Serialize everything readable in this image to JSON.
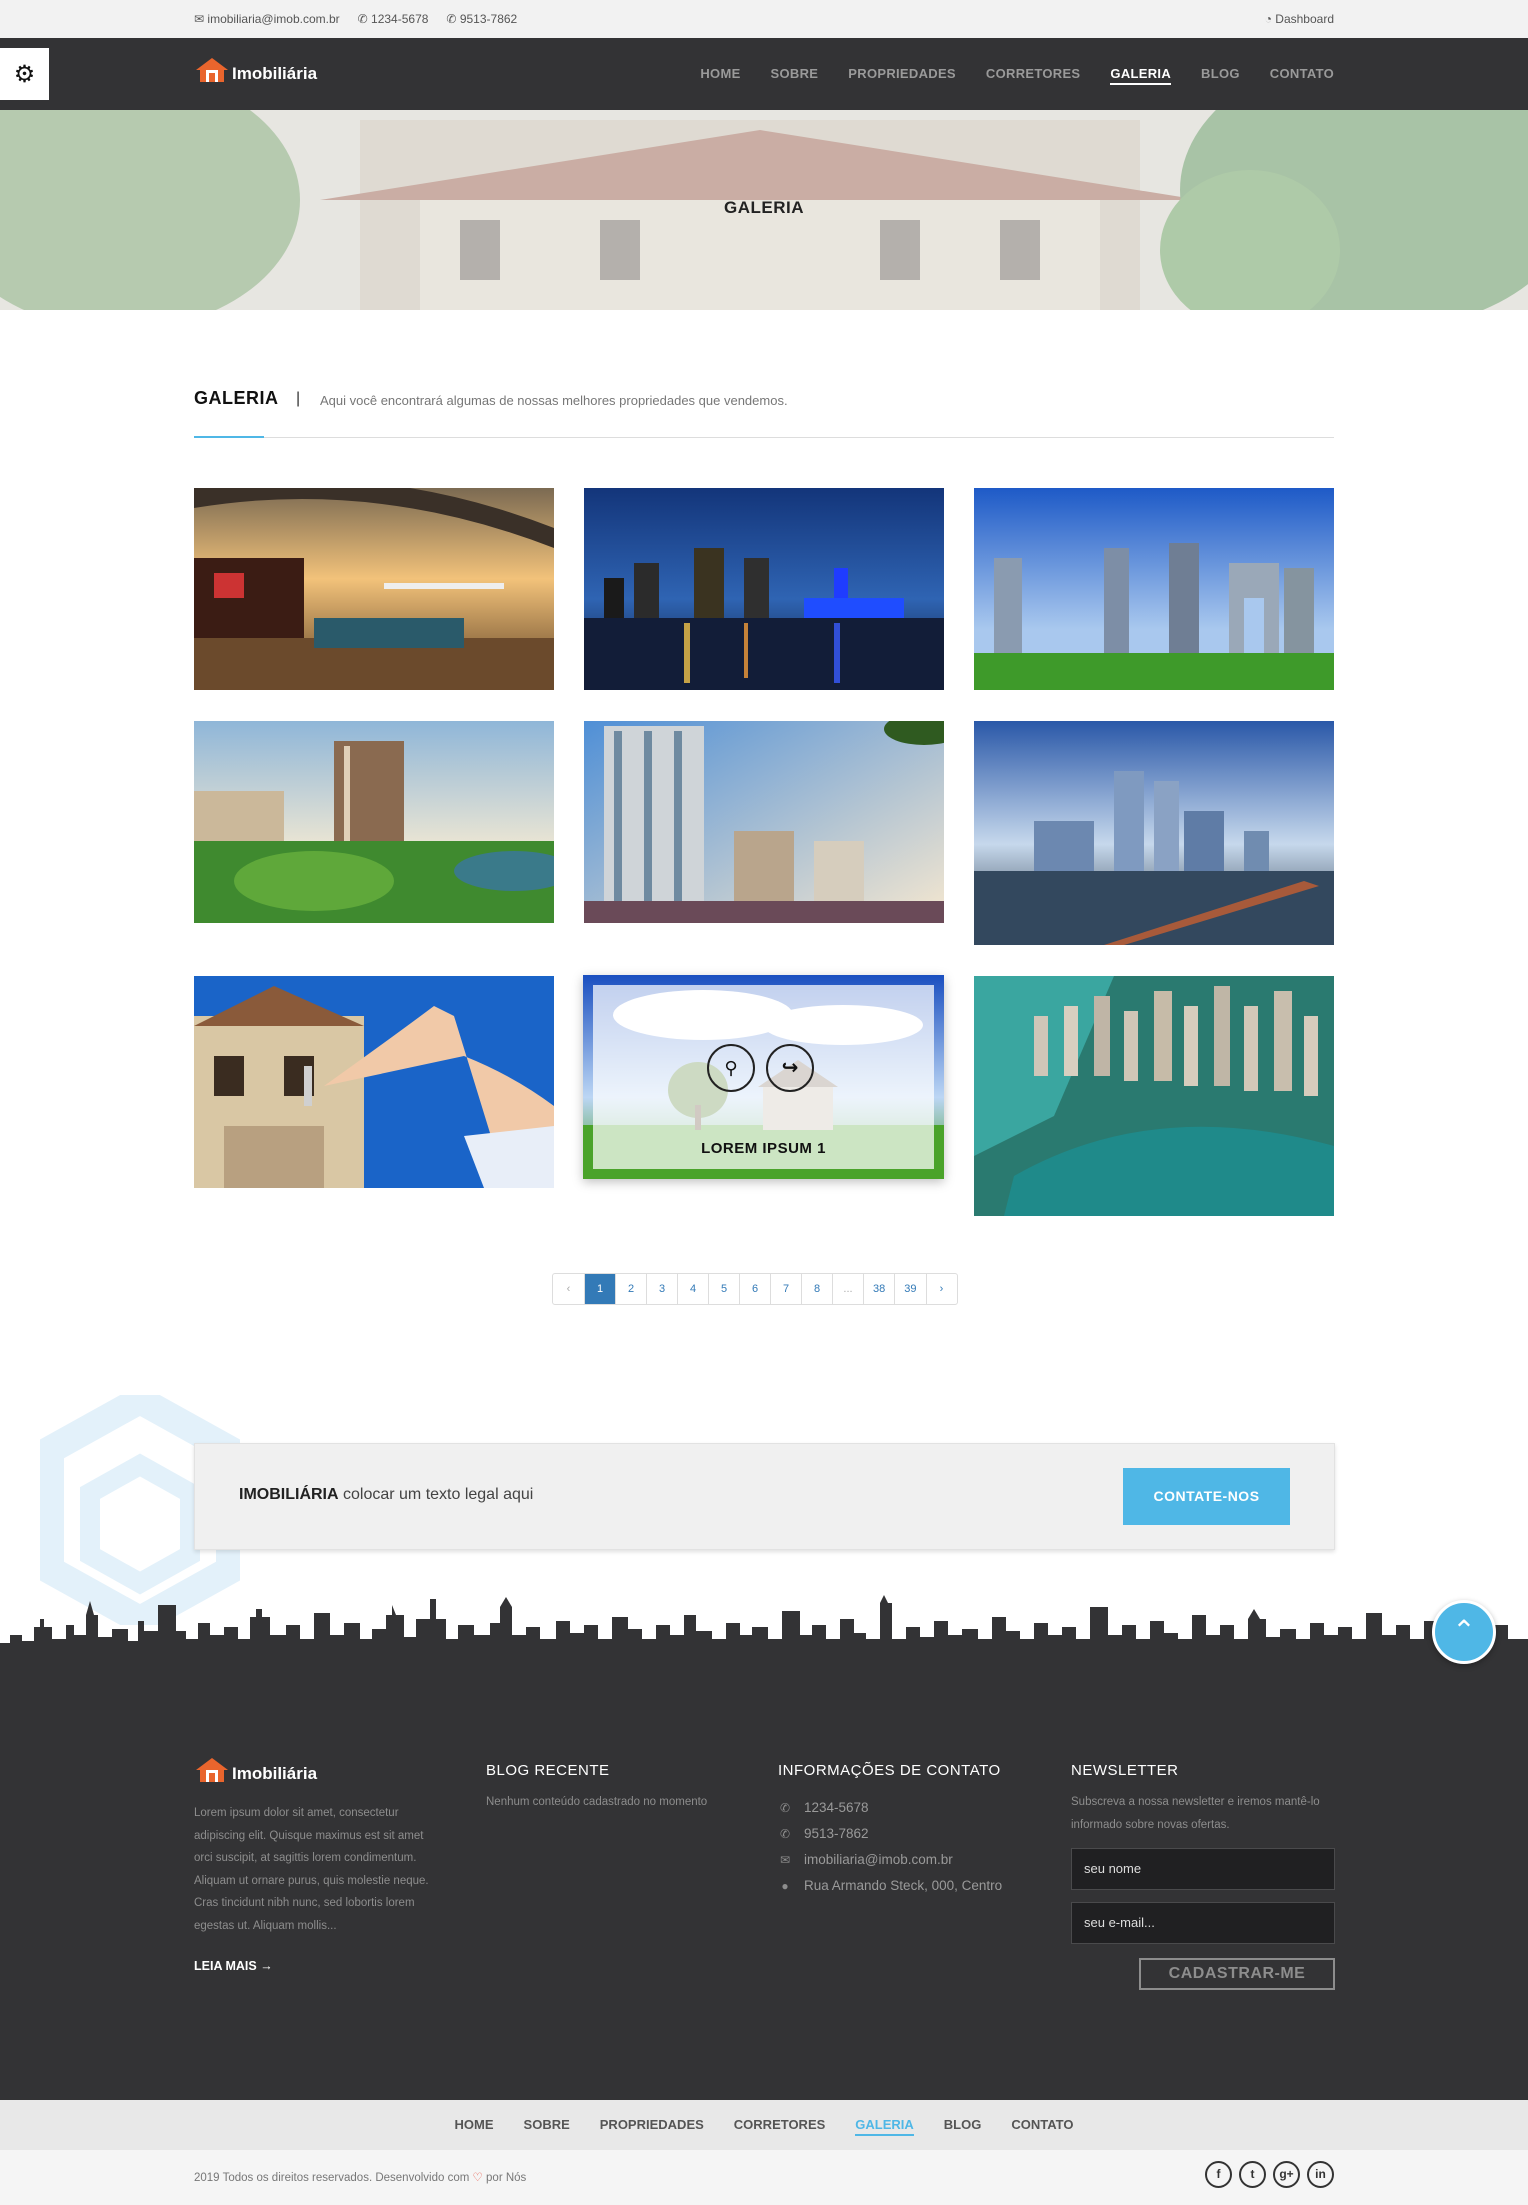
{
  "topbar": {
    "email": "imobiliaria@imob.com.br",
    "phone1": "1234-5678",
    "phone2": "9513-7862",
    "dashboard": "Dashboard"
  },
  "brand": {
    "name": "Imobiliária"
  },
  "nav": {
    "items": [
      "HOME",
      "SOBRE",
      "PROPRIEDADES",
      "CORRETORES",
      "GALERIA",
      "BLOG",
      "CONTATO"
    ],
    "active": "GALERIA"
  },
  "hero": {
    "title": "GALERIA"
  },
  "section": {
    "title": "GALERIA",
    "separator": "|",
    "description": "Aqui você encontrará algumas de nossas melhores propriedades que vendemos."
  },
  "gallery": {
    "hover_caption": "LOREM IPSUM 1",
    "icons": [
      "search-icon",
      "share-icon"
    ]
  },
  "pagination": {
    "prev": "‹",
    "pages": [
      "1",
      "2",
      "3",
      "4",
      "5",
      "6",
      "7",
      "8",
      "...",
      "38",
      "39"
    ],
    "next": "›",
    "current": "1"
  },
  "cta": {
    "brand": "IMOBILIÁRIA",
    "text": " colocar um texto legal aqui",
    "button": "CONTATE-NOS"
  },
  "footer": {
    "about": {
      "text": "Lorem ipsum dolor sit amet, consectetur adipiscing elit. Quisque maximus est sit amet orci suscipit, at sagittis lorem condimentum. Aliquam ut ornare purus, quis molestie neque. Cras tincidunt nibh nunc, sed lobortis lorem egestas ut. Aliquam mollis...",
      "read_more": "LEIA MAIS"
    },
    "blog": {
      "title": "BLOG RECENTE",
      "empty": "Nenhum conteúdo cadastrado no momento"
    },
    "contact": {
      "title": "INFORMAÇÕES DE CONTATO",
      "phone1": "1234-5678",
      "phone2": "9513-7862",
      "email": "imobiliaria@imob.com.br",
      "address": "Rua Armando Steck, 000, Centro"
    },
    "newsletter": {
      "title": "NEWSLETTER",
      "text": "Subscreva a nossa newsletter e iremos mantê-lo informado sobre novas ofertas.",
      "name_placeholder": "seu nome",
      "email_placeholder": "seu e-mail...",
      "button": "CADASTRAR-ME"
    }
  },
  "bottom_nav": {
    "items": [
      "HOME",
      "SOBRE",
      "PROPRIEDADES",
      "CORRETORES",
      "GALERIA",
      "BLOG",
      "CONTATO"
    ],
    "active": "GALERIA"
  },
  "copyright": {
    "prefix": "2019 Todos os direitos reservados. Desenvolvido com",
    "heart": "♡",
    "suffix": "por Nós"
  },
  "social": [
    "f",
    "t",
    "g+",
    "in"
  ],
  "colors": {
    "accent": "#4fb7e6",
    "dark": "#333335",
    "page_blue": "#337ab7"
  }
}
